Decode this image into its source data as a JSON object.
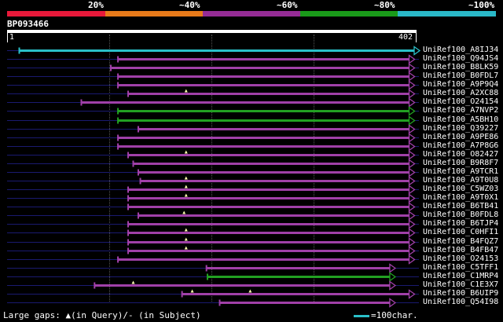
{
  "scale": {
    "labels": [
      "20%",
      "~40%",
      "~60%",
      "~80%",
      "~100%"
    ],
    "colors": [
      "#e8193a",
      "#e87a1a",
      "#952c95",
      "#1a9a1a",
      "#2ab8c8"
    ]
  },
  "query": {
    "id": "BP093466",
    "start": "1",
    "end": "402"
  },
  "query_length": 402,
  "colors": {
    "background": "#000000",
    "query_line": "#1a1a70",
    "hit_magenta": "#a040a8",
    "hit_green": "#22a022",
    "hit_cyan": "#2ac0c8",
    "gap_marker": "#ffffb0"
  },
  "hits": [
    {
      "label": "UniRef100_A8IJ34",
      "start": 13,
      "end": 402,
      "color": "cyan",
      "gaps": []
    },
    {
      "label": "UniRef100_Q94JS4",
      "start": 110,
      "end": 397,
      "color": "magenta",
      "gaps": []
    },
    {
      "label": "UniRef100_B8LK59",
      "start": 103,
      "end": 397,
      "color": "magenta",
      "gaps": []
    },
    {
      "label": "UniRef100_B0FDL7",
      "start": 110,
      "end": 397,
      "color": "magenta",
      "gaps": []
    },
    {
      "label": "UniRef100_A9P9Q4",
      "start": 110,
      "end": 397,
      "color": "magenta",
      "gaps": []
    },
    {
      "label": "UniRef100_A2XC88",
      "start": 120,
      "end": 397,
      "color": "magenta",
      "gaps": [
        177
      ]
    },
    {
      "label": "UniRef100_O24154",
      "start": 74,
      "end": 397,
      "color": "magenta",
      "gaps": []
    },
    {
      "label": "UniRef100_A7NVP2",
      "start": 110,
      "end": 397,
      "color": "green",
      "gaps": []
    },
    {
      "label": "UniRef100_A5BH10",
      "start": 110,
      "end": 397,
      "color": "green",
      "gaps": []
    },
    {
      "label": "UniRef100_Q39227",
      "start": 130,
      "end": 397,
      "color": "magenta",
      "gaps": []
    },
    {
      "label": "UniRef100_A9PE86",
      "start": 110,
      "end": 397,
      "color": "magenta",
      "gaps": []
    },
    {
      "label": "UniRef100_A7P8G6",
      "start": 110,
      "end": 397,
      "color": "magenta",
      "gaps": []
    },
    {
      "label": "UniRef100_O82427",
      "start": 120,
      "end": 397,
      "color": "magenta",
      "gaps": [
        177
      ]
    },
    {
      "label": "UniRef100_B9R8F7",
      "start": 125,
      "end": 397,
      "color": "magenta",
      "gaps": []
    },
    {
      "label": "UniRef100_A9TCR1",
      "start": 130,
      "end": 397,
      "color": "magenta",
      "gaps": []
    },
    {
      "label": "UniRef100_A9T0U8",
      "start": 132,
      "end": 397,
      "color": "magenta",
      "gaps": [
        177
      ]
    },
    {
      "label": "UniRef100_C5WZ03",
      "start": 120,
      "end": 397,
      "color": "magenta",
      "gaps": [
        177
      ]
    },
    {
      "label": "UniRef100_A9T0X1",
      "start": 120,
      "end": 397,
      "color": "magenta",
      "gaps": [
        177
      ]
    },
    {
      "label": "UniRef100_B6TB41",
      "start": 120,
      "end": 397,
      "color": "magenta",
      "gaps": []
    },
    {
      "label": "UniRef100_B0FDL8",
      "start": 130,
      "end": 397,
      "color": "magenta",
      "gaps": [
        175
      ]
    },
    {
      "label": "UniRef100_B6TJP4",
      "start": 120,
      "end": 397,
      "color": "magenta",
      "gaps": []
    },
    {
      "label": "UniRef100_C0HFI1",
      "start": 120,
      "end": 397,
      "color": "magenta",
      "gaps": [
        177
      ]
    },
    {
      "label": "UniRef100_B4FQZ7",
      "start": 120,
      "end": 397,
      "color": "magenta",
      "gaps": [
        177
      ]
    },
    {
      "label": "UniRef100_B4FB47",
      "start": 120,
      "end": 397,
      "color": "magenta",
      "gaps": [
        177
      ]
    },
    {
      "label": "UniRef100_O24153",
      "start": 110,
      "end": 397,
      "color": "magenta",
      "gaps": []
    },
    {
      "label": "UniRef100_C5TFF1",
      "start": 197,
      "end": 378,
      "color": "magenta",
      "gaps": []
    },
    {
      "label": "UniRef100_C1MRP4",
      "start": 198,
      "end": 378,
      "color": "green",
      "gaps": []
    },
    {
      "label": "UniRef100_C1E3X7",
      "start": 87,
      "end": 378,
      "color": "magenta",
      "gaps": [
        125
      ]
    },
    {
      "label": "UniRef100_B6UIP9",
      "start": 173,
      "end": 397,
      "color": "magenta",
      "gaps": [
        183,
        240
      ]
    },
    {
      "label": "UniRef100_Q54I98",
      "start": 210,
      "end": 378,
      "color": "magenta",
      "gaps": []
    }
  ],
  "legend": {
    "gaps_text": "Large gaps: ▲(in Query)/- (in Subject)",
    "scale_text": "=100char."
  }
}
